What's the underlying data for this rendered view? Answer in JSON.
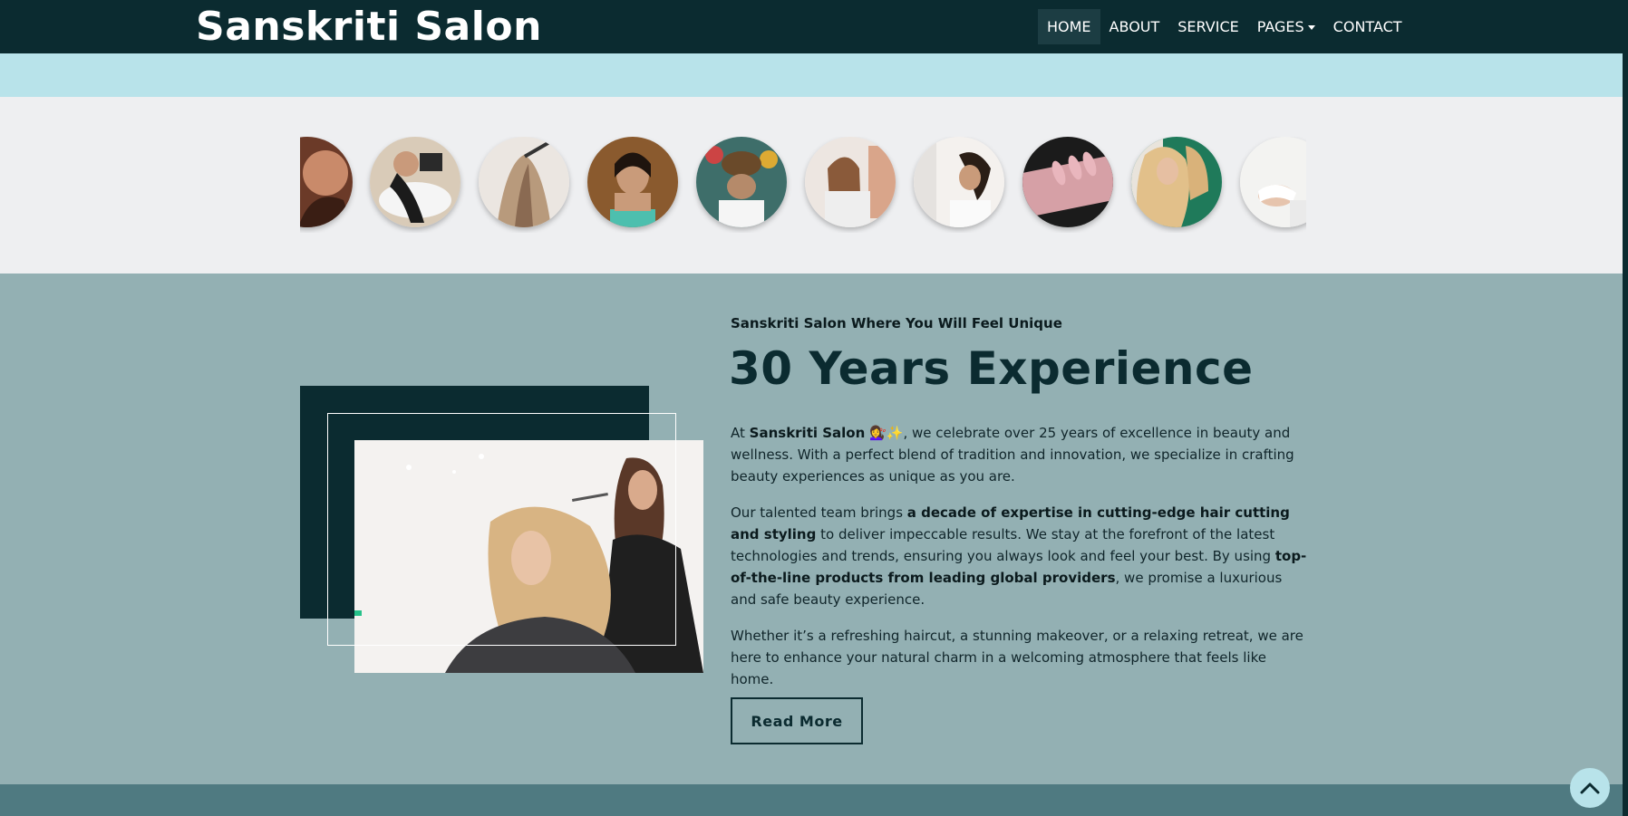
{
  "brand": {
    "name": "Sanskriti Salon"
  },
  "nav": {
    "items": [
      {
        "label": "HOME",
        "active": true
      },
      {
        "label": "ABOUT",
        "active": false
      },
      {
        "label": "SERVICE",
        "active": false
      },
      {
        "label": "PAGES",
        "active": false,
        "dropdown": true
      },
      {
        "label": "CONTACT",
        "active": false
      }
    ]
  },
  "gallery": {
    "images": [
      "hair-styling-photo",
      "hair-wash-photo",
      "hair-coloring-photo",
      "ear-care-photo",
      "head-massage-photo",
      "hair-drying-photo",
      "underarm-care-photo",
      "manicure-photo",
      "blonde-waves-photo",
      "facial-treatment-photo"
    ]
  },
  "about": {
    "tagline": "Sanskriti Salon Where You Will Feel Unique",
    "heading": "30 Years Experience",
    "p1": {
      "prefix": "At ",
      "brand": "Sanskriti Salon",
      "emoji": "💇‍♀️✨",
      "rest": ", we celebrate over 25 years of excellence in beauty and wellness. With a perfect blend of tradition and innovation, we specialize in crafting beauty experiences as unique as you are."
    },
    "p2": {
      "prefix": "Our talented team brings ",
      "bold1": "a decade of expertise in cutting-edge hair cutting and styling",
      "middle": " to deliver impeccable results. We stay at the forefront of the latest technologies and trends, ensuring you always look and feel your best. By using ",
      "bold2": "top-of-the-line products from leading global providers",
      "suffix": ", we promise a luxurious and safe beauty experience."
    },
    "p3": "Whether it’s a refreshing haircut, a stunning makeover, or a relaxing retreat, we are here to enhance your natural charm in a welcoming atmosphere that feels like home.",
    "button_label": "Read More"
  },
  "colors": {
    "navbar": "#0b2b30",
    "strip": "#b8e3ea",
    "gallery_bg": "#eeeff1",
    "about_bg": "#93b0b3",
    "bottom_band": "#4f7a81",
    "accent_green": "#26c18a"
  },
  "back_to_top": {
    "icon": "chevron-up-icon"
  }
}
